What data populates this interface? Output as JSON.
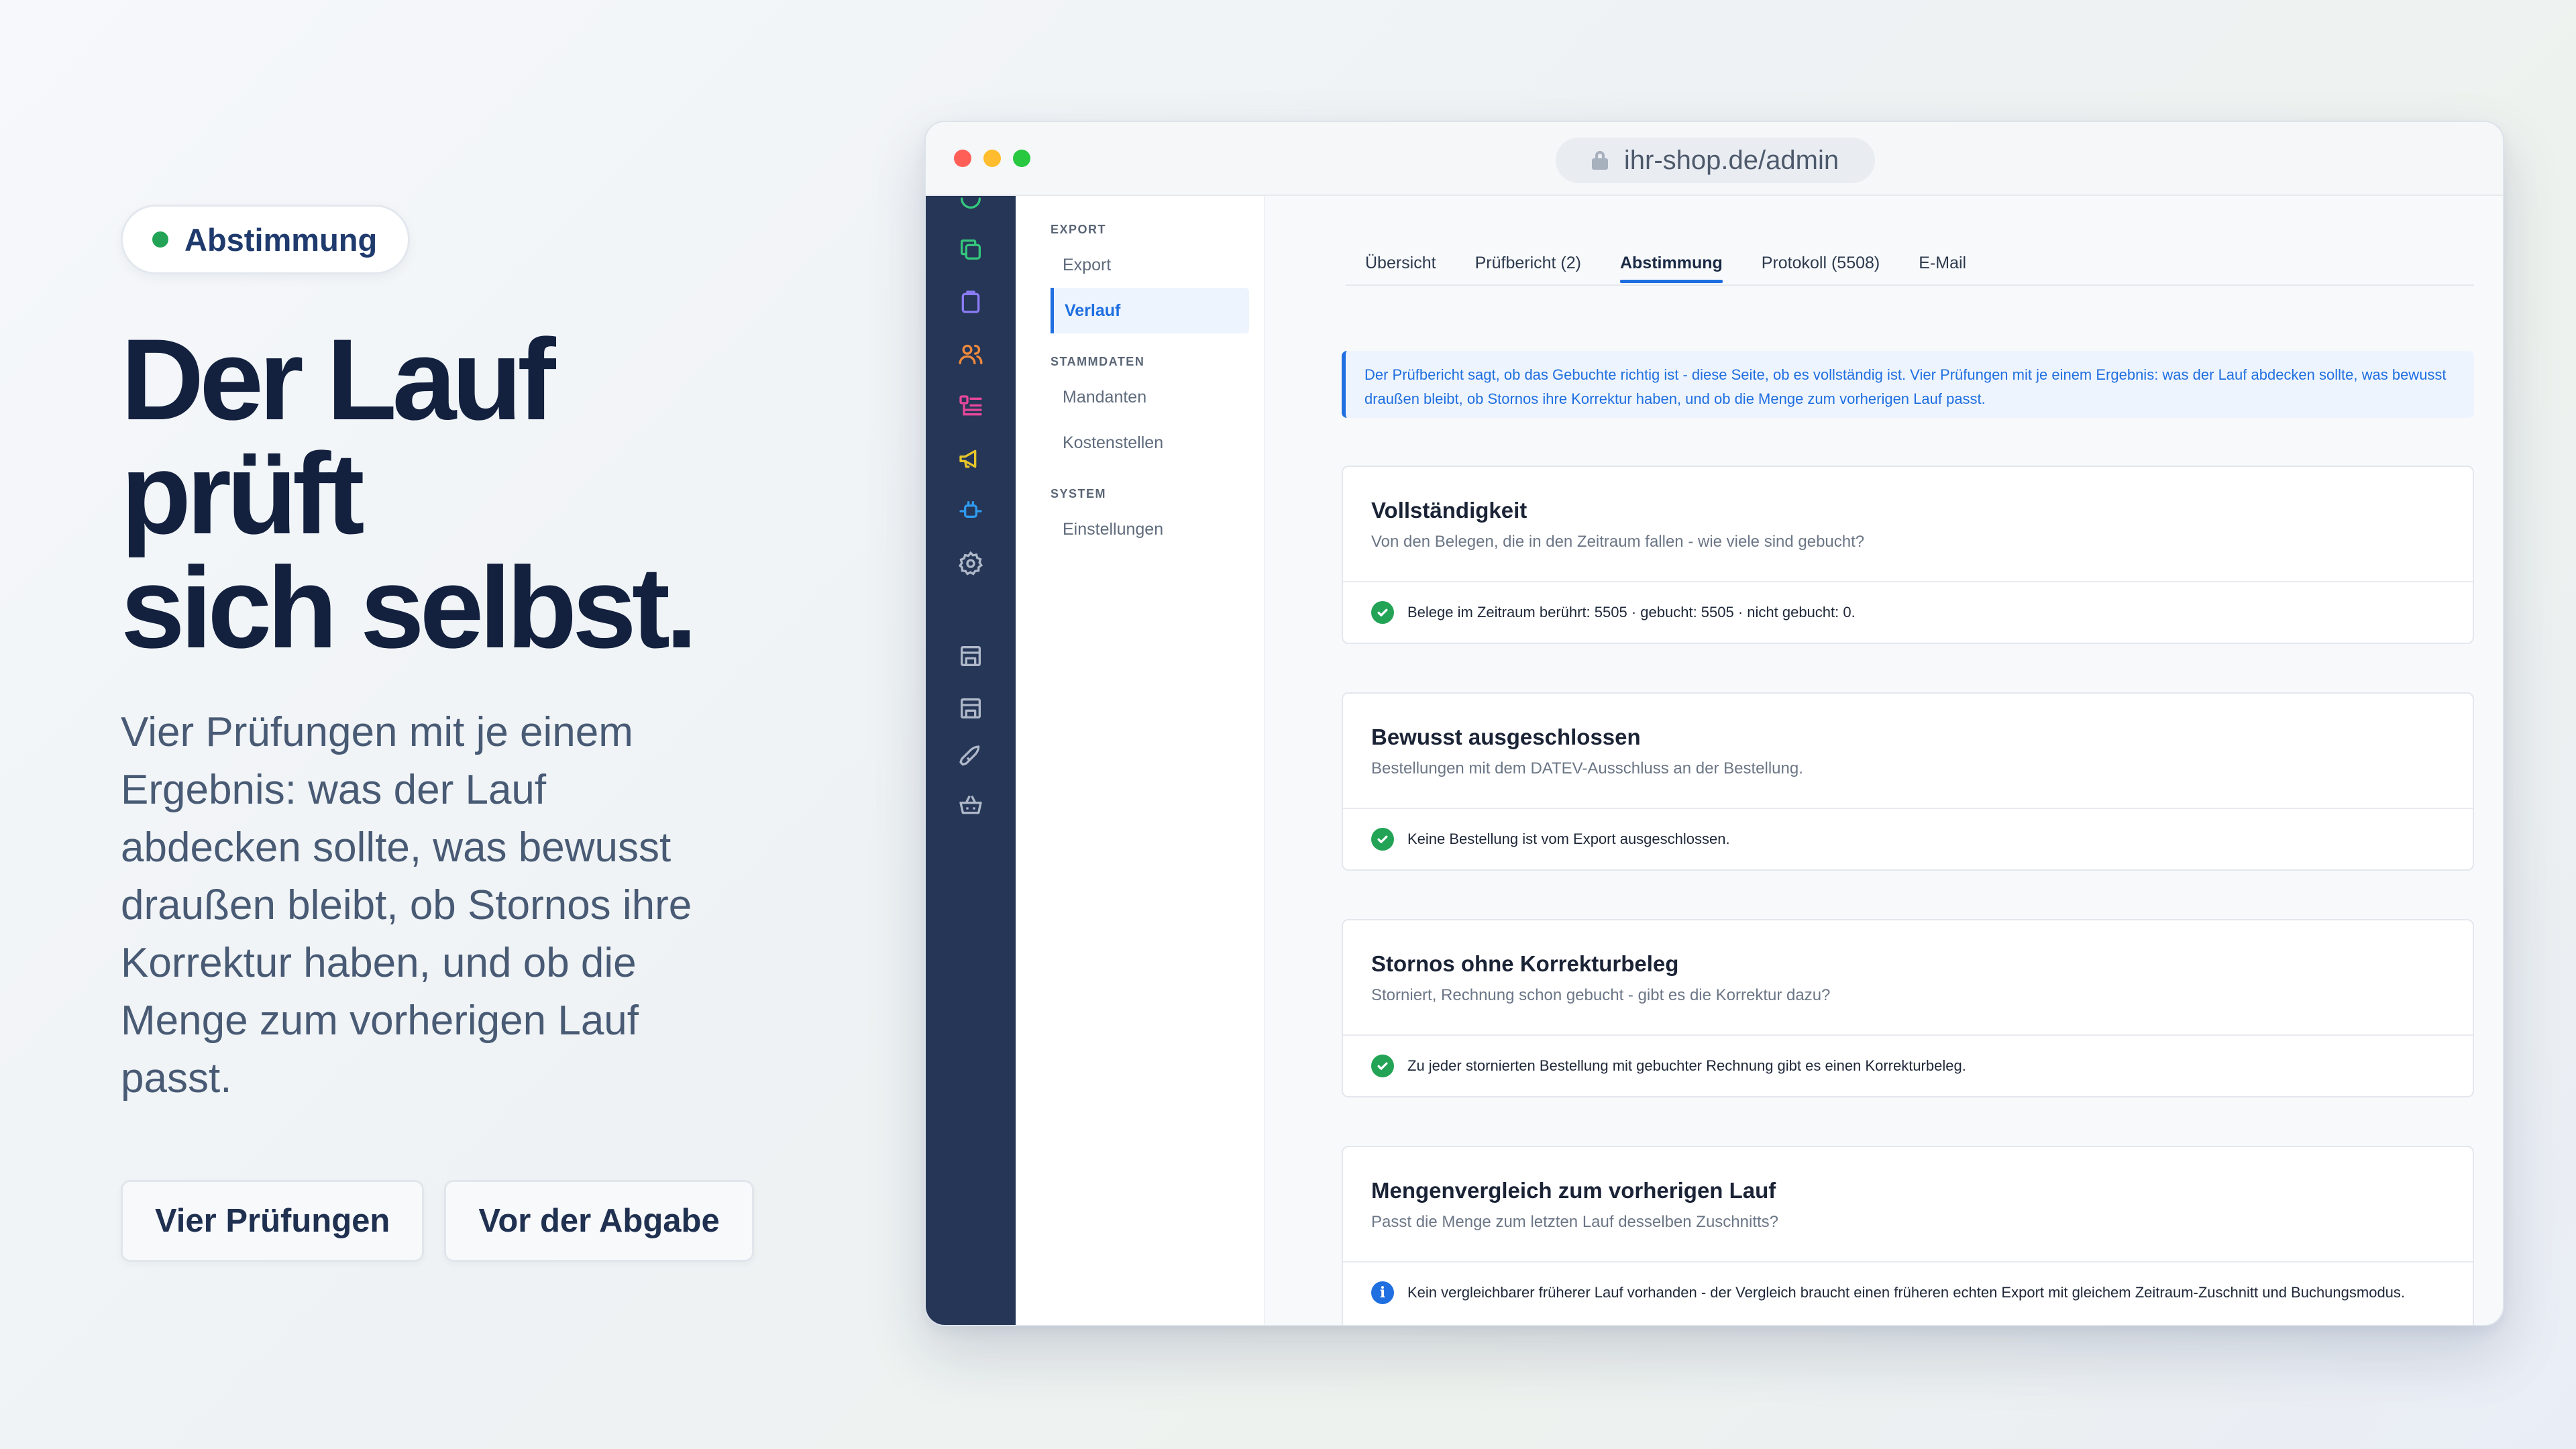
{
  "hero": {
    "badge": "Abstimmung",
    "headline": [
      "Der Lauf",
      "prüft",
      "sich selbst."
    ],
    "lede": "Vier Prüfungen mit je einem Ergebnis: was der Lauf abdecken sollte, was bewusst draußen bleibt, ob Stornos ihre Korrektur haben, und ob die Menge zum vorherigen Lauf passt.",
    "buttons": [
      "Vier Prüfungen",
      "Vor der Abgabe"
    ]
  },
  "browser": {
    "url": "ihr-shop.de/admin"
  },
  "rail": {
    "icons": [
      "tag-icon",
      "copy-icon",
      "clipboard-icon",
      "users-icon",
      "list-icon",
      "megaphone-icon",
      "plug-icon",
      "settings-icon",
      "store-icon",
      "store-alt-icon",
      "rocket-icon",
      "basket-icon"
    ]
  },
  "subnav": {
    "sections": [
      {
        "title": "EXPORT",
        "items": [
          "Export",
          "Verlauf"
        ]
      },
      {
        "title": "STAMMDATEN",
        "items": [
          "Mandanten",
          "Kostenstellen"
        ]
      },
      {
        "title": "SYSTEM",
        "items": [
          "Einstellungen"
        ]
      }
    ],
    "active": "Verlauf"
  },
  "main": {
    "tabs": [
      "Übersicht",
      "Prüfbericht (2)",
      "Abstimmung",
      "Protokoll (5508)",
      "E-Mail"
    ],
    "active_tab": "Abstimmung",
    "info": "Der Prüfbericht sagt, ob das Gebuchte richtig ist - diese Seite, ob es vollständig ist. Vier Prüfungen mit je einem Ergebnis: was der Lauf abdecken sollte, was bewusst draußen bleibt, ob Stornos ihre Korrektur haben, und ob die Menge zum vorherigen Lauf passt.",
    "checks": [
      {
        "title": "Vollständigkeit",
        "subtitle": "Von den Belegen, die in den Zeitraum fallen - wie viele sind gebucht?",
        "status": "ok",
        "result": "Belege im Zeitraum berührt: 5505 · gebucht: 5505 · nicht gebucht: 0."
      },
      {
        "title": "Bewusst ausgeschlossen",
        "subtitle": "Bestellungen mit dem DATEV-Ausschluss an der Bestellung.",
        "status": "ok",
        "result": "Keine Bestellung ist vom Export ausgeschlossen."
      },
      {
        "title": "Stornos ohne Korrekturbeleg",
        "subtitle": "Storniert, Rechnung schon gebucht - gibt es die Korrektur dazu?",
        "status": "ok",
        "result": "Zu jeder stornierten Bestellung mit gebuchter Rechnung gibt es einen Korrekturbeleg."
      },
      {
        "title": "Mengenvergleich zum vorherigen Lauf",
        "subtitle": "Passt die Menge zum letzten Lauf desselben Zuschnitts?",
        "status": "info",
        "result": "Kein vergleichbarer früherer Lauf vorhanden - der Vergleich braucht einen früheren echten Export mit gleichem Zeitraum-Zuschnitt und Buchungsmodus."
      }
    ]
  },
  "colors": {
    "accent": "#1f6fe0",
    "success": "#22a355",
    "rail": "#263657",
    "headline": "#13213f"
  }
}
